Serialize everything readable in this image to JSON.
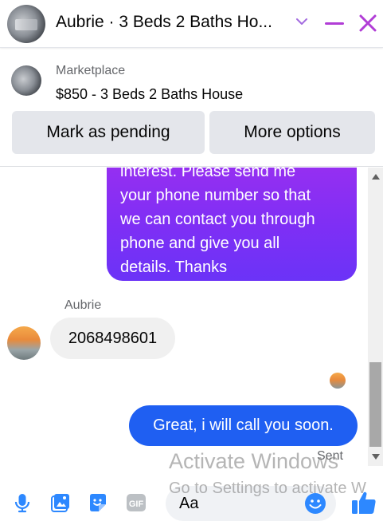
{
  "header": {
    "title": "Aubrie · 3 Beds 2 Baths Ho...",
    "accent_color": "#b13dd6",
    "icons": [
      "chevron-down-icon",
      "minimize-icon",
      "close-icon"
    ]
  },
  "marketplace": {
    "label": "Marketplace",
    "item": "$850 - 3 Beds 2 Baths House",
    "mark_pending_label": "Mark as pending",
    "more_options_label": "More options"
  },
  "messages": {
    "outgoing_long_lines": [
      "interest. Please send me",
      "your phone number so that",
      "we can contact you through",
      "phone and give you all",
      "details. Thanks"
    ],
    "incoming_sender": "Aubrie",
    "incoming_text": "2068498601",
    "outgoing_text": "Great, i will call you soon.",
    "status": "Sent"
  },
  "watermark": {
    "line1": "Activate Windows",
    "line2": "Go to Settings to activate W"
  },
  "composer": {
    "placeholder": "Aa",
    "icons": [
      "mic-icon",
      "photo-icon",
      "sticker-icon",
      "gif-icon",
      "emoji-icon",
      "like-icon"
    ],
    "icon_color": "#2d88ff"
  }
}
